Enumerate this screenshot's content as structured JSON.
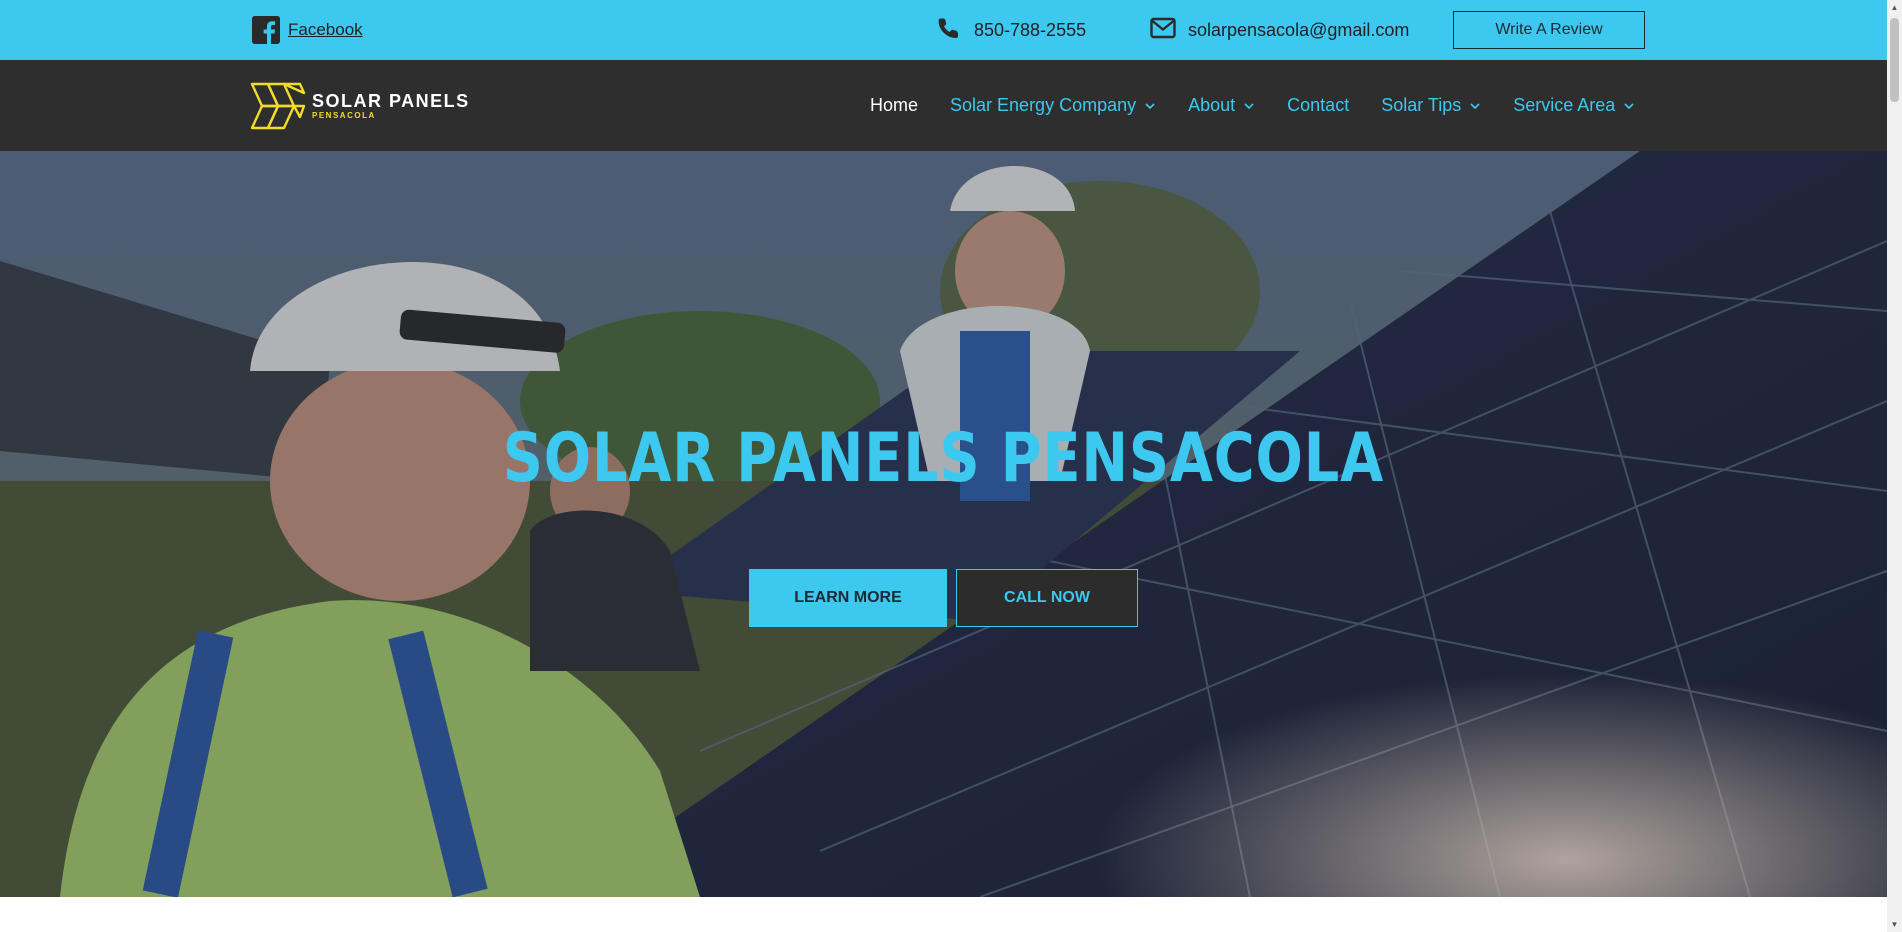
{
  "topbar": {
    "facebook_label": "Facebook",
    "phone": "850-788-2555",
    "email": "solarpensacola@gmail.com",
    "review_button": "Write A Review"
  },
  "logo": {
    "title": "SOLAR PANELS",
    "subtitle": "PENSACOLA"
  },
  "nav": {
    "items": [
      {
        "label": "Home",
        "active": true,
        "dropdown": false
      },
      {
        "label": "Solar Energy Company",
        "active": false,
        "dropdown": true
      },
      {
        "label": "About",
        "active": false,
        "dropdown": true
      },
      {
        "label": "Contact",
        "active": false,
        "dropdown": false
      },
      {
        "label": "Solar Tips",
        "active": false,
        "dropdown": true
      },
      {
        "label": "Service Area",
        "active": false,
        "dropdown": true
      }
    ]
  },
  "hero": {
    "title": "SOLAR PANELS PENSACOLA",
    "learn_more": "LEARN MORE",
    "call_now": "CALL NOW"
  },
  "colors": {
    "accent": "#3cc8ef",
    "nav_bg": "#2e2e2e",
    "logo_yellow": "#f2dc2a"
  },
  "icons": {
    "facebook": "facebook-icon",
    "phone": "phone-icon",
    "email": "envelope-icon",
    "dropdown": "chevron-down-icon"
  }
}
